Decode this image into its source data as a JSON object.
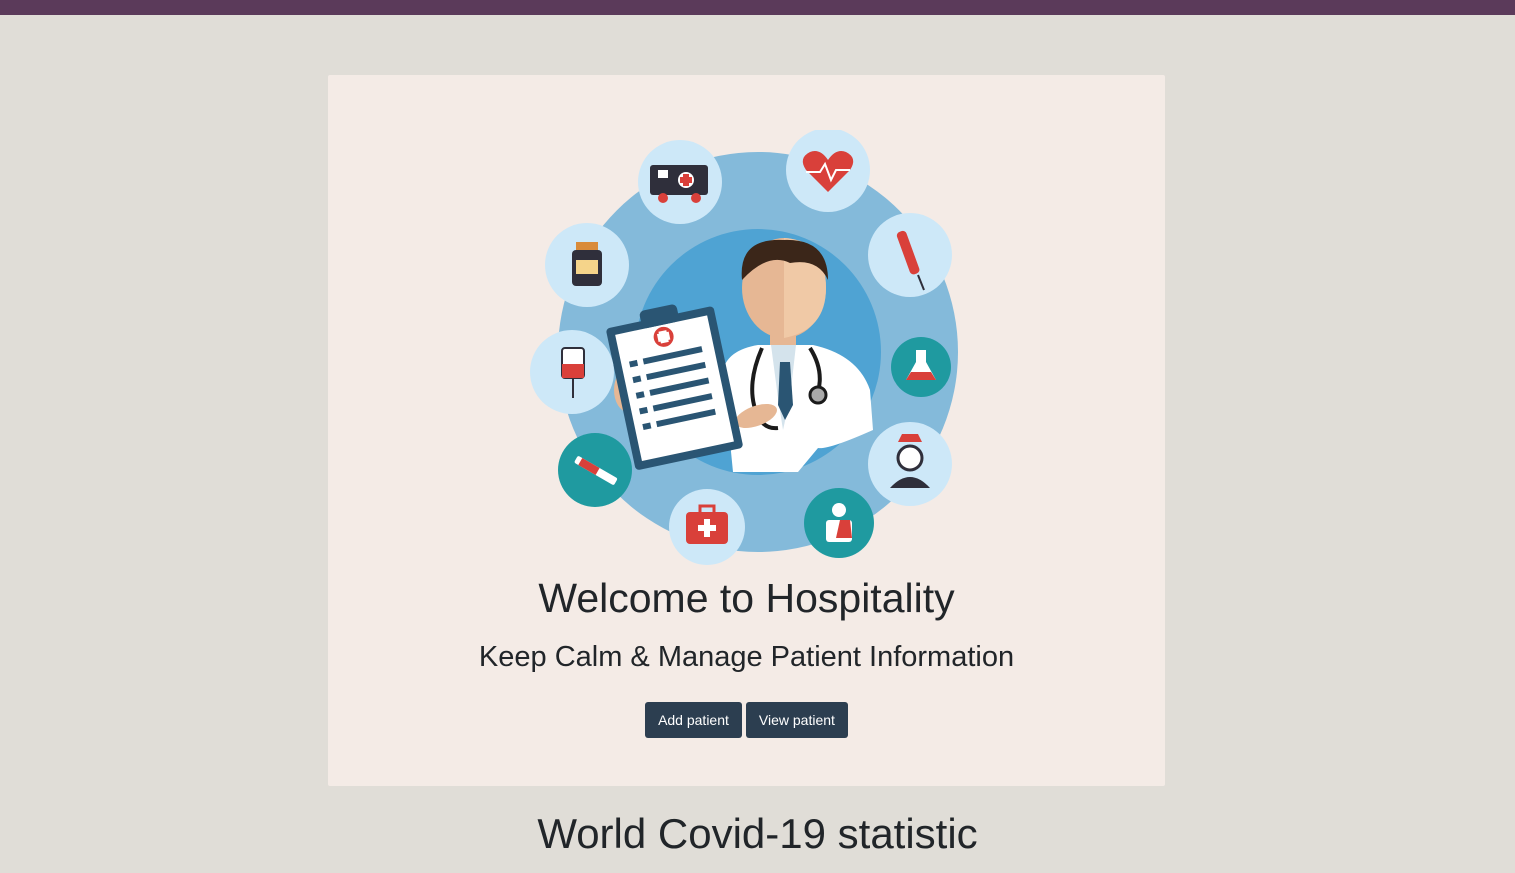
{
  "header": {
    "bar_color": "#5b3a5a"
  },
  "hero": {
    "title": "Welcome to Hospitality",
    "subtitle": "Keep Calm & Manage Patient Information",
    "illustration": "doctor-with-clipboard-and-medical-icons",
    "icons": [
      "ambulance-icon",
      "heart-pulse-icon",
      "dropper-icon",
      "flask-icon",
      "nurse-icon",
      "patient-icon",
      "first-aid-kit-icon",
      "syringe-icon",
      "iv-bag-icon",
      "pill-bottle-icon"
    ]
  },
  "actions": {
    "add_label": "Add patient",
    "view_label": "View patient"
  },
  "stats": {
    "title": "World Covid-19 statistic"
  },
  "colors": {
    "background": "#e0ddd7",
    "card": "#f4ebe6",
    "button": "#2c3e50",
    "accent_blue": "#7fb8da",
    "accent_teal": "#1f9aa0",
    "icon_red": "#d9403a"
  }
}
